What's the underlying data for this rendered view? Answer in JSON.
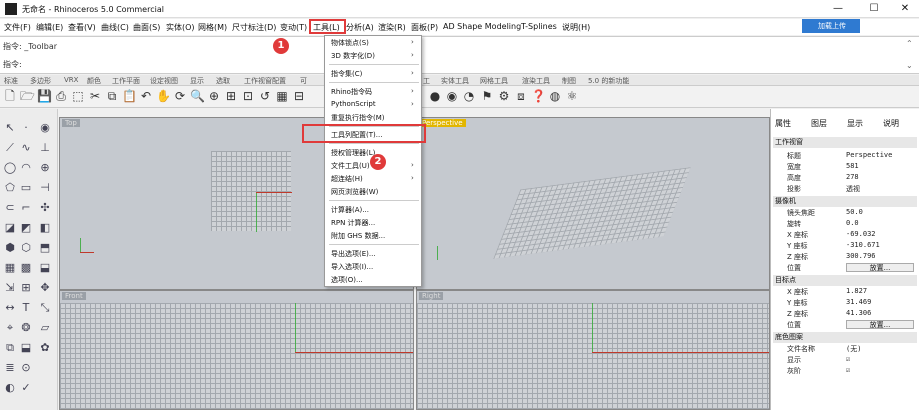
{
  "window": {
    "title": "无命名 - Rhinoceros 5.0 Commercial",
    "min": "—",
    "max": "☐",
    "close": "✕"
  },
  "menubar": {
    "items": [
      "文件(F)",
      "编辑(E)",
      "查看(V)",
      "曲线(C)",
      "曲面(S)",
      "实体(O)",
      "网格(M)",
      "尺寸标注(D)",
      "变动(T)",
      "工具(L)",
      "分析(A)",
      "渲染(R)",
      "面板(P)",
      "AD Shape Modeling",
      "T-Splines",
      "说明(H)"
    ],
    "login": "加载上传"
  },
  "command": {
    "line1": "指令: _Toolbar",
    "line2": "指令:"
  },
  "tabs": [
    "标准",
    "多边形",
    "VRX",
    "颜色",
    "工作平面",
    "设定视图",
    "显示",
    "选取",
    "工作视窗配置",
    "可",
    "工",
    "实体工具",
    "网格工具",
    "渲染工具",
    "制图",
    "5.0 的新功能"
  ],
  "viewports": {
    "top": "Top",
    "perspective": "Perspective",
    "front": "Front",
    "right": "Right"
  },
  "tools_menu": {
    "items": [
      "物体锁点(S)",
      "3D 数字化(D)",
      "指令集(C)",
      "Rhino指令码",
      "PythonScript",
      "重复执行指令(M)",
      "工具列配置(T)...",
      "授权管理器(L)",
      "文件工具(U)",
      "超连结(H)",
      "网页浏览器(W)",
      "计算器(A)...",
      "RPN 计算器...",
      "附加 GHS 数据...",
      "导出选项(E)...",
      "导入选项(I)...",
      "选项(O)..."
    ]
  },
  "annotations": {
    "badge1": "1",
    "badge2": "2"
  },
  "properties": {
    "tabs": [
      "属性",
      "图层",
      "显示",
      "说明"
    ],
    "section_viewport": "工作视窗",
    "labels": {
      "title": "标题",
      "width": "宽度",
      "height": "高度",
      "projection": "投影"
    },
    "values": {
      "title": "Perspective",
      "width": "581",
      "height": "278",
      "projection": "透视"
    },
    "section_camera": "摄像机",
    "camera_labels": [
      "镜头焦距",
      "旋转",
      "X 座标",
      "Y 座标",
      "Z 座标",
      "位置"
    ],
    "camera_values": [
      "50.0",
      "0.0",
      "-69.032",
      "-310.671",
      "300.796",
      "放置..."
    ],
    "section_target": "目标点",
    "target_labels": [
      "X 座标",
      "Y 座标",
      "Z 座标",
      "位置"
    ],
    "target_values": [
      "1.827",
      "31.469",
      "41.306",
      "放置..."
    ],
    "section_wallpaper": "底色图案",
    "wall_labels": [
      "文件名称",
      "显示",
      "灰阶"
    ],
    "wall_values": [
      "(无)",
      "☑",
      "☑"
    ]
  },
  "colors": {
    "accent_red": "#e03a3a",
    "blue": "#2f7ad1"
  }
}
